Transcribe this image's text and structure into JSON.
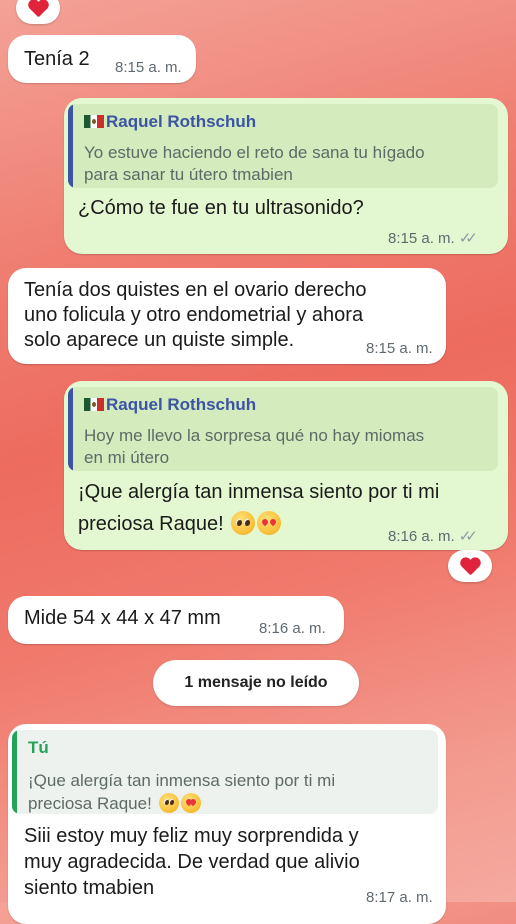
{
  "messages": [
    {
      "text": "Tenía 2",
      "time": "8:15 a. m."
    },
    {
      "quote": {
        "author": "Raquel Rothschuh",
        "line1": "Yo estuve haciendo el reto de sana tu hígado",
        "line2": "para sanar tu útero tmabien"
      },
      "text": "¿Cómo te fue en tu ultrasonido?",
      "time": "8:15 a. m."
    },
    {
      "lines": [
        "Tenía dos quistes en el ovario derecho",
        "uno folicula y otro endometrial y ahora",
        "solo aparece un quiste simple."
      ],
      "time": "8:15 a. m."
    },
    {
      "quote": {
        "author": "Raquel Rothschuh",
        "line1": "Hoy me llevo la sorpresa qué no hay miomas",
        "line2": "en mi útero"
      },
      "line1": "¡Que alergía tan inmensa siento por ti mi",
      "line2": "preciosa Raque!",
      "time": "8:16 a. m."
    },
    {
      "text": "Mide 54 x 44 x 47 mm",
      "time": "8:16 a. m."
    },
    {
      "quote": {
        "author": "Tú",
        "line1": "¡Que alergía tan inmensa siento por ti mi",
        "line2": "preciosa Raque!"
      },
      "lines": [
        "Siii estoy muy feliz muy sorprendida y",
        "muy agradecida. De verdad que alivio",
        "siento tmabien"
      ],
      "time": "8:17 a. m."
    }
  ],
  "unread_label": "1 mensaje no leído",
  "icons": {
    "reaction": "red-heart-icon",
    "read_receipt": "double-check-icon",
    "emoji_pleading": "pleading-face-icon",
    "emoji_hearts": "smiling-face-with-hearts-icon",
    "flag": "mexico-flag-icon"
  },
  "colors": {
    "incoming_bubble": "#ffffff",
    "outgoing_bubble": "#e3f8d0",
    "quote_author": "#3d54a4",
    "quote_bar_other": "#3d54a4",
    "quote_bar_self": "#25a35a",
    "reaction_heart": "#e0243c"
  }
}
